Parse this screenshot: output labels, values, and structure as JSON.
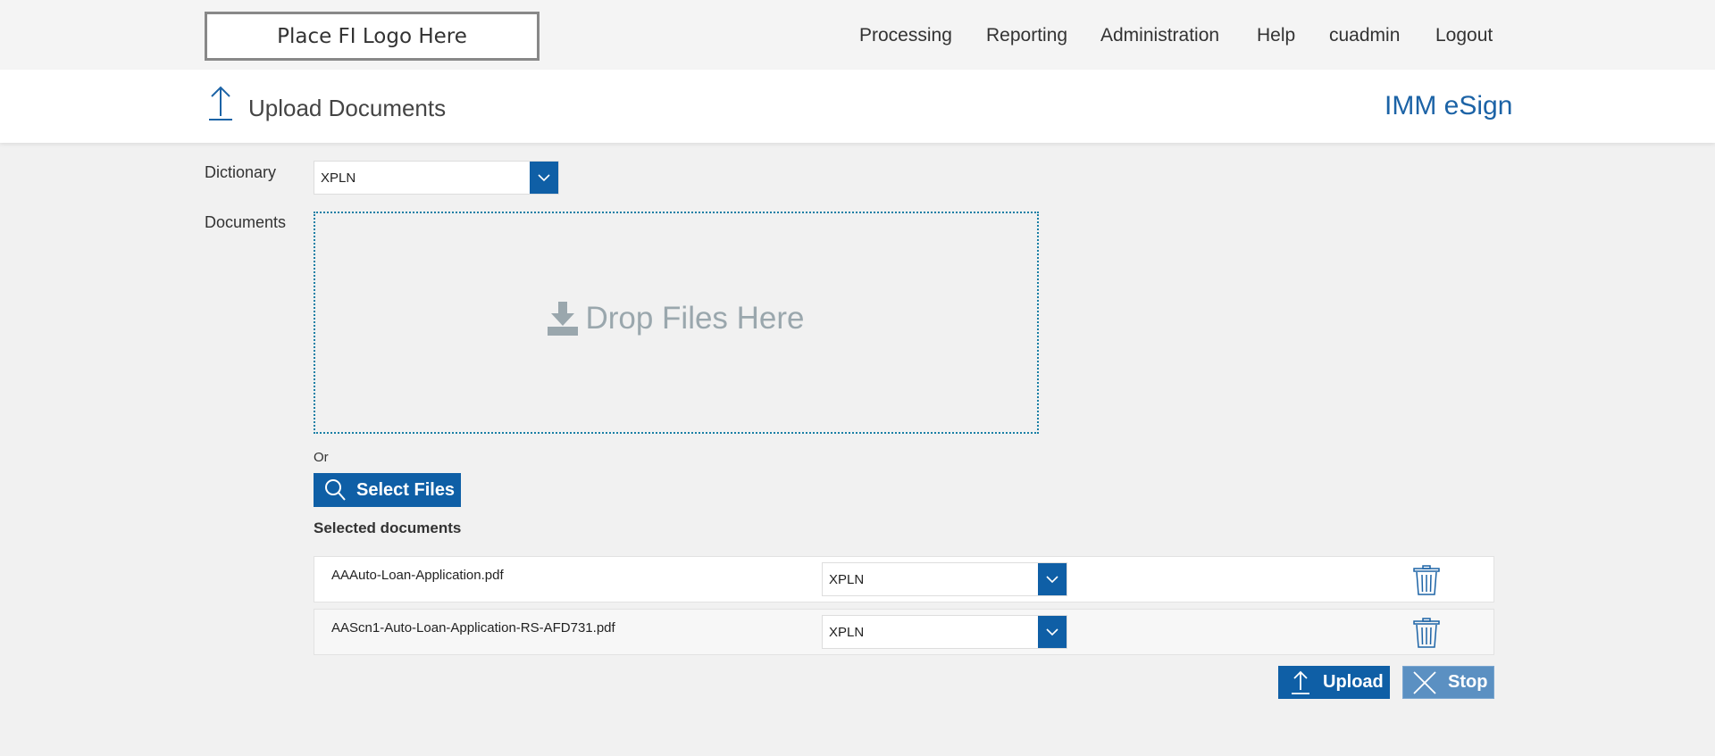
{
  "topbar": {
    "logo": "Place FI Logo Here",
    "nav": [
      "Processing",
      "Reporting",
      "Administration",
      "Help",
      "cuadmin",
      "Logout"
    ]
  },
  "header": {
    "title": "Upload Documents",
    "brand": "IMM eSign"
  },
  "form": {
    "dictionary_label": "Dictionary",
    "dictionary_value": "XPLN",
    "documents_label": "Documents",
    "drop_text": "Drop Files Here",
    "or_text": "Or",
    "select_files_label": "Select Files",
    "selected_title": "Selected documents"
  },
  "documents": [
    {
      "name": "AAAuto-Loan-Application.pdf",
      "dictionary": "XPLN"
    },
    {
      "name": "AAScn1-Auto-Loan-Application-RS-AFD731.pdf",
      "dictionary": "XPLN"
    }
  ],
  "actions": {
    "upload_label": "Upload",
    "stop_label": "Stop"
  },
  "colors": {
    "primary": "#0f5fa6",
    "brand": "#1c63a6",
    "stop": "#5b90c2",
    "drop_border": "#1a7fa5"
  }
}
